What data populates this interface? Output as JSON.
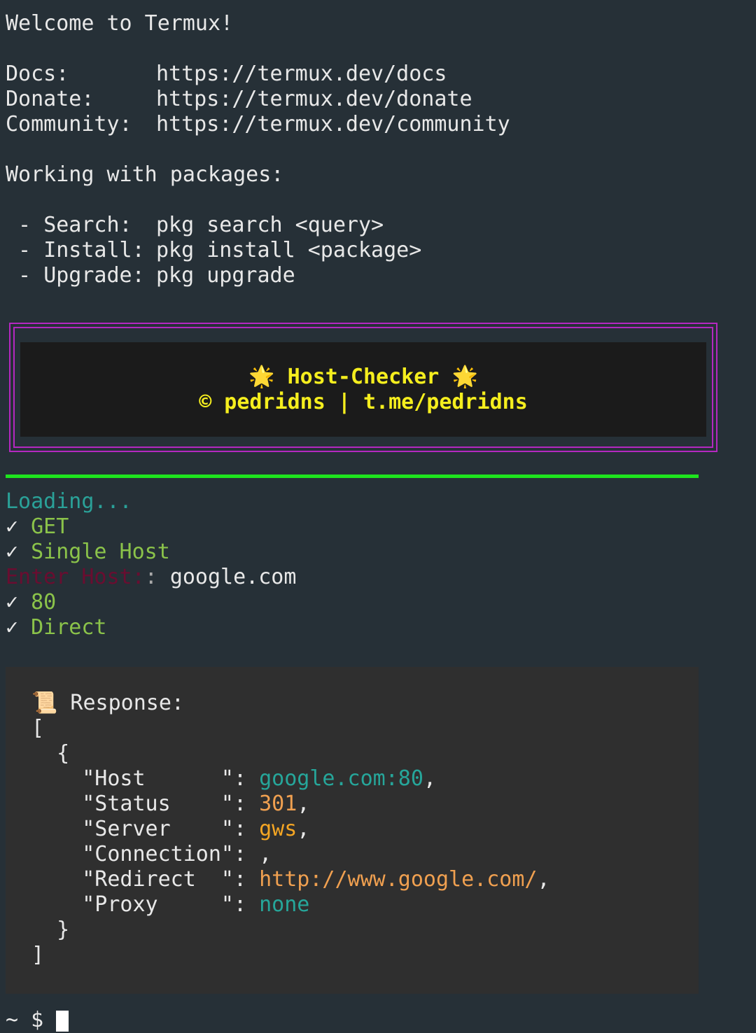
{
  "motd": {
    "welcome": "Welcome to Termux!",
    "links": [
      {
        "label": "Docs:",
        "url": "https://termux.dev/docs"
      },
      {
        "label": "Donate:",
        "url": "https://termux.dev/donate"
      },
      {
        "label": "Community:",
        "url": "https://termux.dev/community"
      }
    ],
    "packages_heading": "Working with packages:",
    "commands": [
      {
        "label": "Search:",
        "cmd": "pkg search <query>"
      },
      {
        "label": "Install:",
        "cmd": "pkg install <package>"
      },
      {
        "label": "Upgrade:",
        "cmd": "pkg upgrade"
      }
    ]
  },
  "banner": {
    "star": "🌟",
    "title": "Host-Checker",
    "credit": "© pedridns | t.me/pedridns"
  },
  "progress": {
    "loading": "Loading...",
    "check": "✓",
    "method": "GET",
    "mode": "Single Host",
    "host_prompt": "Enter Host:",
    "host_value": "google.com",
    "port": "80",
    "proxy_mode": "Direct"
  },
  "response": {
    "icon": "📜",
    "heading": "Response:",
    "fields": [
      {
        "key": "\"Host      \"",
        "value": "google.com:80",
        "color": "#26a69a"
      },
      {
        "key": "\"Status    \"",
        "value": "301",
        "color": "#f0a050"
      },
      {
        "key": "\"Server    \"",
        "value": "gws",
        "color": "#f5a623"
      },
      {
        "key": "\"Connection\"",
        "value": "",
        "color": "#e8e8e8"
      },
      {
        "key": "\"Redirect  \"",
        "value": "http://www.google.com/",
        "color": "#f0a050"
      },
      {
        "key": "\"Proxy     \"",
        "value": "none",
        "color": "#26a69a"
      }
    ]
  },
  "prompt": {
    "text": "~ $"
  },
  "colors": {
    "background": "#263037",
    "banner_border": "#b428c0",
    "divider": "#1ee41e"
  }
}
